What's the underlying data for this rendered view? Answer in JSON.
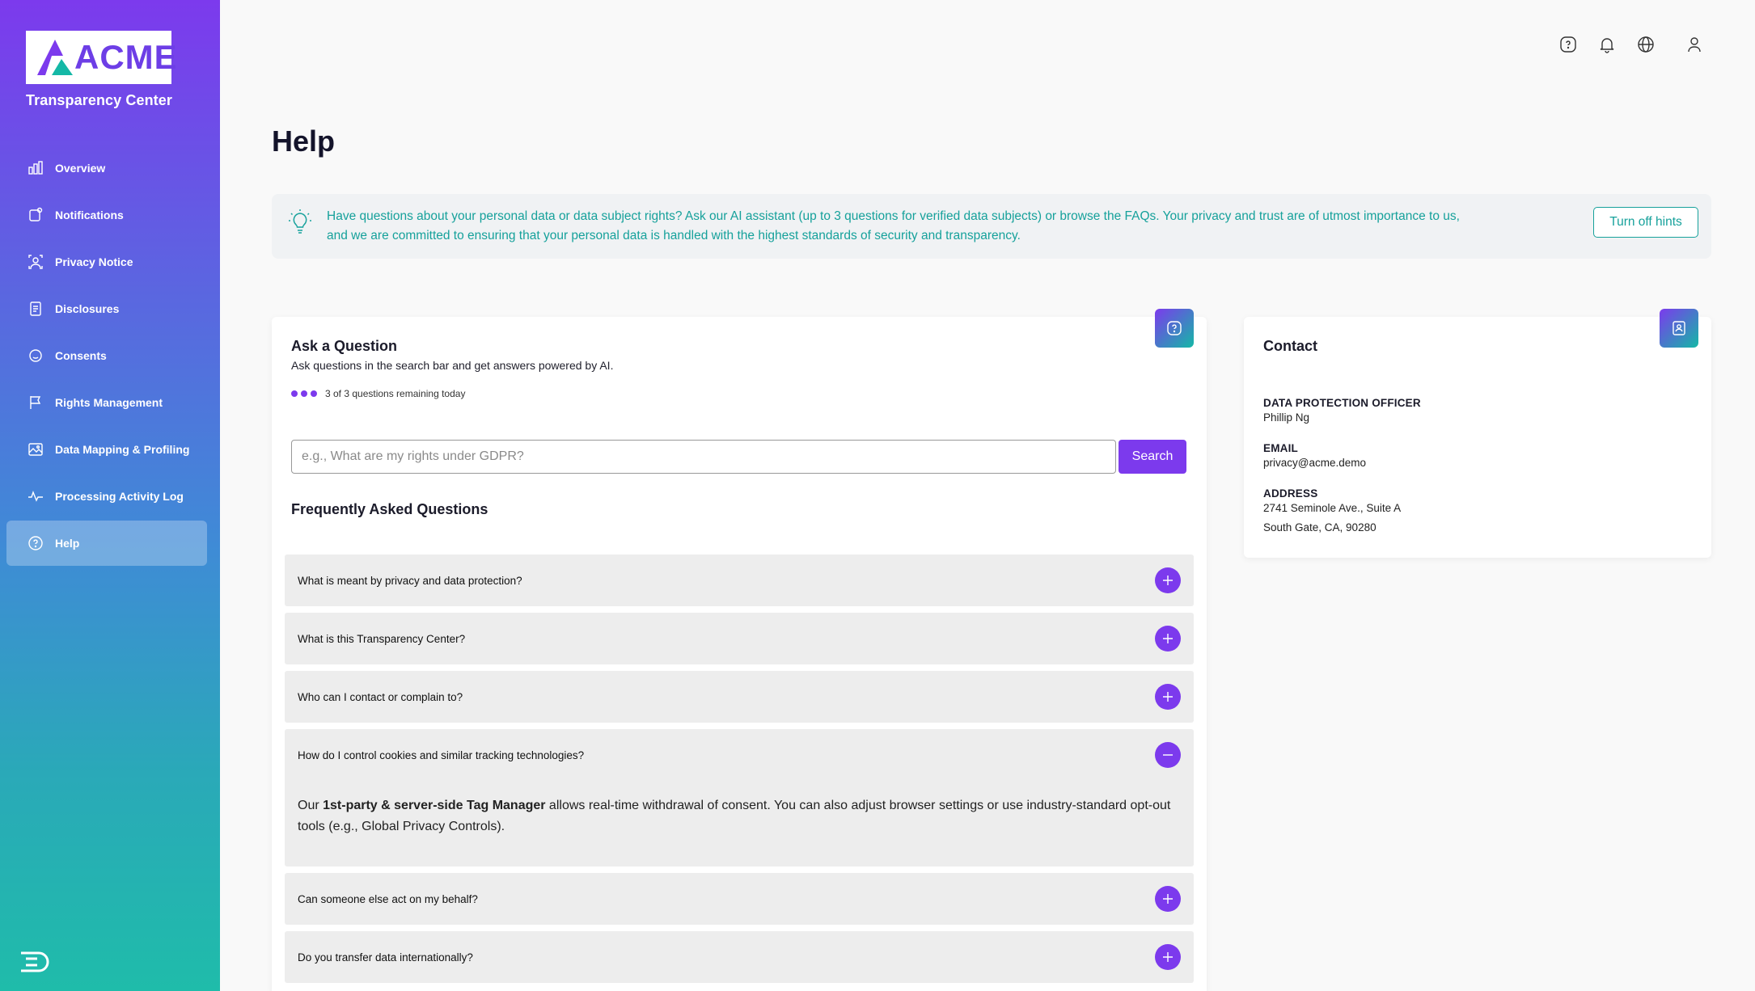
{
  "sidebar": {
    "logo_text": "ACME",
    "subtitle": "Transparency Center",
    "items": [
      {
        "label": "Overview",
        "icon": "bar-chart-icon"
      },
      {
        "label": "Notifications",
        "icon": "notification-icon"
      },
      {
        "label": "Privacy Notice",
        "icon": "privacy-icon"
      },
      {
        "label": "Disclosures",
        "icon": "document-icon"
      },
      {
        "label": "Consents",
        "icon": "consent-icon"
      },
      {
        "label": "Rights Management",
        "icon": "flag-icon"
      },
      {
        "label": "Data Mapping & Profiling",
        "icon": "image-map-icon"
      },
      {
        "label": "Processing Activity Log",
        "icon": "activity-icon"
      },
      {
        "label": "Help",
        "icon": "help-icon",
        "active": true
      }
    ],
    "footer_icon": "brand-mark-icon"
  },
  "topbar": {
    "icons": [
      "help-icon",
      "bell-icon",
      "globe-icon",
      "user-icon"
    ]
  },
  "page": {
    "title": "Help"
  },
  "hint": {
    "icon": "lightbulb-icon",
    "text": "Have questions about your personal data or data subject rights? Ask our AI assistant (up to 3 questions for verified data subjects) or browse the FAQs. Your privacy and trust are of utmost importance to us, and we are committed to ensuring that your personal data is handled with the highest standards of security and transparency.",
    "button_label": "Turn off hints"
  },
  "ask": {
    "title": "Ask a Question",
    "subtitle": "Ask questions in the search bar and get answers powered by AI.",
    "remaining": "3 of 3 questions remaining today",
    "search_placeholder": "e.g., What are my rights under GDPR?",
    "search_value": "",
    "search_button": "Search",
    "faq_heading": "Frequently Asked Questions"
  },
  "faqs": [
    {
      "question": "What is meant by privacy and data protection?",
      "open": false
    },
    {
      "question": "What is this Transparency Center?",
      "open": false
    },
    {
      "question": "Who can I contact or complain to?",
      "open": false
    },
    {
      "question": "How do I control cookies and similar tracking technologies?",
      "open": true,
      "answer_prefix": "Our ",
      "answer_bold": "1st-party & server-side Tag Manager",
      "answer_suffix": " allows real-time withdrawal of consent. You can also adjust browser settings or use industry-standard opt-out tools (e.g., Global Privacy Controls)."
    },
    {
      "question": "Can someone else act on my behalf?",
      "open": false
    },
    {
      "question": "Do you transfer data internationally?",
      "open": false
    }
  ],
  "contact": {
    "title": "Contact",
    "dpo_label": "DATA PROTECTION OFFICER",
    "dpo_value": "Phillip Ng",
    "email_label": "EMAIL",
    "email_value": "privacy@acme.demo",
    "address_label": "ADDRESS",
    "address_line1": "2741 Seminole Ave., Suite A",
    "address_line2": "South Gate, CA, 90280"
  },
  "colors": {
    "accent": "#7c3aed",
    "teal": "#16a19b"
  }
}
